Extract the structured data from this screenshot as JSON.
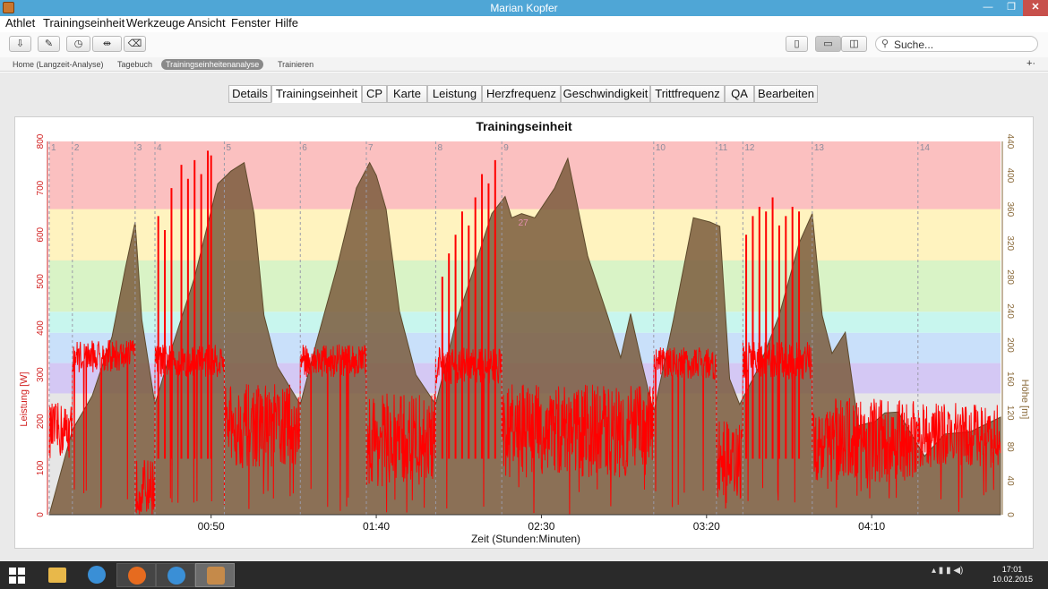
{
  "window": {
    "title": "Marian Kopfer"
  },
  "menu": [
    "Athlet",
    "Trainingseinheit",
    "Werkzeuge",
    "Ansicht",
    "Fenster",
    "Hilfe"
  ],
  "toolbar": {
    "search_placeholder": "Suche..."
  },
  "nav": {
    "items": [
      "Home (Langzeit-Analyse)",
      "Tagebuch",
      "Trainingseinheitenanalyse",
      "Trainieren"
    ],
    "active": "Trainingseinheitenanalyse",
    "plus": "+·"
  },
  "tabs": {
    "items": [
      "Details",
      "Trainingseinheit",
      "CP",
      "Karte",
      "Leistung",
      "Herzfrequenz",
      "Geschwindigkeit",
      "Trittfrequenz",
      "QA",
      "Bearbeiten"
    ],
    "active": "Trainingseinheit"
  },
  "chart_data": {
    "type": "area",
    "title": "Trainingseinheit",
    "xlabel": "Zeit (Stunden:Minuten)",
    "ylabel_left": "Leistung [W]",
    "ylabel_right": "Höhe [m]",
    "x_ticks": [
      "00:50",
      "01:40",
      "02:30",
      "03:20",
      "04:10"
    ],
    "x_tick_minutes": [
      50,
      100,
      150,
      200,
      250
    ],
    "xlim_minutes": [
      1,
      289
    ],
    "y_left_ticks": [
      0,
      100,
      200,
      300,
      400,
      500,
      600,
      700,
      800
    ],
    "y_left_lim": [
      0,
      800
    ],
    "y_right_ticks": [
      0,
      40,
      80,
      120,
      160,
      200,
      240,
      280,
      320,
      360,
      400,
      440
    ],
    "y_right_lim": [
      0,
      440
    ],
    "power_zones": [
      {
        "from": 0,
        "to": 260,
        "color": "#e6e6e6"
      },
      {
        "from": 260,
        "to": 325,
        "color": "#d4c8f4"
      },
      {
        "from": 325,
        "to": 390,
        "color": "#c9e0fa"
      },
      {
        "from": 390,
        "to": 435,
        "color": "#c8f6ee"
      },
      {
        "from": 435,
        "to": 545,
        "color": "#d9f3c6"
      },
      {
        "from": 545,
        "to": 800,
        "color": "#fbc3c3"
      }
    ],
    "top_zone_color": "#fff3bf",
    "top_zone": {
      "from": 545,
      "to": 655
    },
    "red_zone": {
      "from": 655,
      "to": 800
    },
    "laps": [
      {
        "label": "1",
        "minute": 1
      },
      {
        "label": "2",
        "minute": 8
      },
      {
        "label": "3",
        "minute": 27
      },
      {
        "label": "4",
        "minute": 33
      },
      {
        "label": "5",
        "minute": 54
      },
      {
        "label": "6",
        "minute": 77
      },
      {
        "label": "7",
        "minute": 97
      },
      {
        "label": "8",
        "minute": 118
      },
      {
        "label": "9",
        "minute": 138
      },
      {
        "label": "10",
        "minute": 184
      },
      {
        "label": "11",
        "minute": 203
      },
      {
        "label": "12",
        "minute": 211
      },
      {
        "label": "13",
        "minute": 232
      },
      {
        "label": "14",
        "minute": 264
      }
    ],
    "altitude_series": {
      "name": "Höhe [m]",
      "x_minutes": [
        1,
        8,
        14,
        20,
        24,
        27,
        29,
        33,
        38,
        45,
        52,
        56,
        60,
        63,
        66,
        70,
        77,
        82,
        88,
        94,
        98,
        100,
        103,
        107,
        112,
        118,
        124,
        130,
        135,
        139,
        141,
        144,
        148,
        154,
        158,
        164,
        170,
        174,
        177,
        180,
        184,
        190,
        196,
        201,
        204,
        207,
        210,
        216,
        222,
        228,
        232,
        235,
        238,
        242,
        246,
        251,
        254,
        258,
        266,
        272,
        280,
        289
      ],
      "values": [
        0,
        100,
        140,
        210,
        290,
        345,
        230,
        130,
        195,
        280,
        390,
        405,
        415,
        355,
        235,
        175,
        130,
        205,
        290,
        385,
        415,
        400,
        360,
        240,
        165,
        130,
        225,
        295,
        355,
        375,
        350,
        355,
        350,
        385,
        420,
        305,
        235,
        185,
        237,
        185,
        120,
        230,
        350,
        345,
        340,
        160,
        130,
        175,
        235,
        320,
        355,
        235,
        190,
        215,
        105,
        110,
        120,
        121,
        69,
        95,
        98,
        115
      ]
    },
    "power_series": {
      "name": "Leistung [W]",
      "segments": [
        {
          "from": 1,
          "to": 8,
          "mean": 180,
          "noise": 60
        },
        {
          "from": 8,
          "to": 27,
          "mean": 340,
          "noise": 35
        },
        {
          "from": 27,
          "to": 33,
          "mean": 60,
          "noise": 60
        },
        {
          "from": 33,
          "to": 54,
          "mean": 330,
          "noise": 35
        },
        {
          "from": 54,
          "to": 77,
          "mean": 190,
          "noise": 90
        },
        {
          "from": 77,
          "to": 97,
          "mean": 330,
          "noise": 35
        },
        {
          "from": 97,
          "to": 118,
          "mean": 160,
          "noise": 100
        },
        {
          "from": 118,
          "to": 138,
          "mean": 320,
          "noise": 40
        },
        {
          "from": 138,
          "to": 184,
          "mean": 180,
          "noise": 100
        },
        {
          "from": 184,
          "to": 203,
          "mean": 325,
          "noise": 35
        },
        {
          "from": 203,
          "to": 211,
          "mean": 120,
          "noise": 90
        },
        {
          "from": 211,
          "to": 232,
          "mean": 330,
          "noise": 40
        },
        {
          "from": 232,
          "to": 264,
          "mean": 160,
          "noise": 90
        },
        {
          "from": 264,
          "to": 289,
          "mean": 170,
          "noise": 70
        }
      ],
      "spikes_minutes": [
        34,
        36,
        38,
        41,
        43,
        45,
        47,
        49,
        50,
        120,
        122,
        124,
        126,
        128,
        130,
        132,
        134,
        136,
        212,
        214,
        216,
        218,
        220,
        222,
        224,
        226,
        228
      ],
      "spike_values": [
        640,
        610,
        700,
        750,
        720,
        760,
        730,
        780,
        770,
        510,
        560,
        600,
        650,
        620,
        680,
        730,
        710,
        760,
        600,
        640,
        660,
        650,
        680,
        620,
        640,
        660,
        650
      ]
    },
    "annotations": [
      "27"
    ],
    "colors": {
      "power": "#ff0000",
      "altitude_fill": "#7a5a3c",
      "altitude_stroke": "#5e4a2c",
      "left_axis": "#d22222",
      "right_axis": "#8a6a3a"
    }
  },
  "taskbar": {
    "clock_time": "17:01",
    "clock_date": "10.02.2015"
  }
}
